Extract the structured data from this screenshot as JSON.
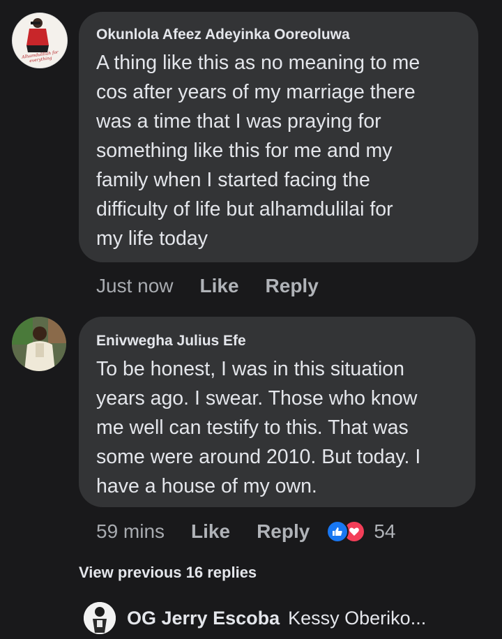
{
  "comments": [
    {
      "author": "Okunlola Afeez Adeyinka Ooreoluwa",
      "lines": [
        "A thing like this as no meaning to me",
        "cos after years of my marriage there",
        "was a time that I was praying for",
        "something like this for me and my",
        "family when I started facing the",
        "difficulty of life but alhamdulilai for",
        "my life today"
      ],
      "time": "Just now",
      "like_label": "Like",
      "reply_label": "Reply",
      "avatar_caption": "Alhamdulillah for everything"
    },
    {
      "author": "Enivwegha Julius Efe",
      "lines": [
        "To be honest, I was in this situation",
        "years ago. I swear. Those who know",
        "me well can testify to this. That was",
        "some were around 2010. But today. I",
        "have a house of my own."
      ],
      "time": "59 mins",
      "like_label": "Like",
      "reply_label": "Reply",
      "reaction_count": "54",
      "reactions": [
        "like-icon",
        "love-icon"
      ]
    }
  ],
  "view_previous": "View previous 16 replies",
  "latest_reply": {
    "author": "OG Jerry Escoba",
    "preview": "Kessy Oberiko..."
  },
  "colors": {
    "background": "#19191b",
    "bubble": "#333436",
    "like_blue": "#1877f2",
    "love_red": "#f33e58"
  }
}
